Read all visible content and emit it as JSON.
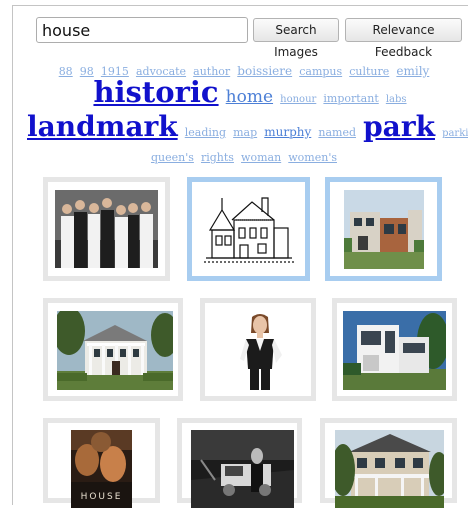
{
  "search": {
    "value": "house",
    "button": "Search Images"
  },
  "feedback_button": "Relevance Feedback",
  "tag_cloud": {
    "line1": [
      "88",
      "98",
      "1915",
      "advocate",
      "author",
      "boissiere",
      "campus",
      "culture",
      "emily"
    ],
    "line2": [
      "historic",
      "home",
      "honour",
      "important",
      "labs"
    ],
    "line3": [
      "landmark",
      "leading",
      "map",
      "murphy",
      "named",
      "park",
      "parking"
    ],
    "line4": [
      "queen's",
      "rights",
      "woman",
      "women's"
    ]
  },
  "results": [
    {
      "name": "cast-group-photo",
      "selected": false
    },
    {
      "name": "victorian-house-sketch",
      "selected": true
    },
    {
      "name": "modern-house-photo",
      "selected": true
    },
    {
      "name": "historic-mansion-photo",
      "selected": false
    },
    {
      "name": "woman-in-vest-photo",
      "selected": false
    },
    {
      "name": "modernist-white-house-photo",
      "selected": false
    },
    {
      "name": "house-poster-image",
      "poster_text": "HOUSE",
      "selected": false
    },
    {
      "name": "black-white-car-photo",
      "selected": false
    },
    {
      "name": "two-storey-house-photo",
      "selected": false
    }
  ]
}
